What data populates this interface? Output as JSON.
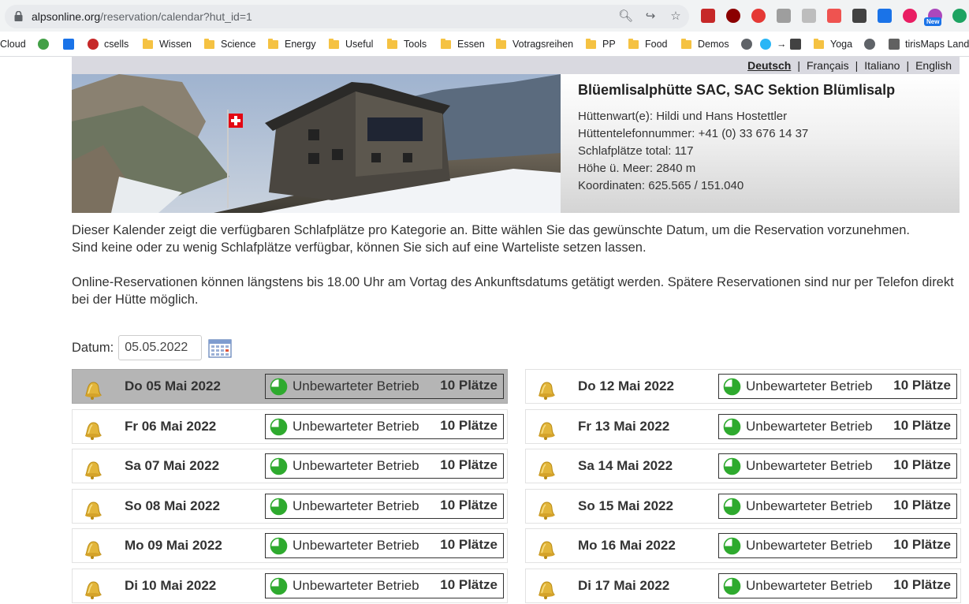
{
  "browser": {
    "url_host": "alpsonline.org",
    "url_path": "/reservation/calendar?hut_id=1",
    "bookmarks": [
      "Cloud",
      "csells",
      "Wissen",
      "Science",
      "Energy",
      "Useful",
      "Tools",
      "Essen",
      "Votragsreihen",
      "PP",
      "Food",
      "Demos",
      "Yoga",
      "tirisMaps Land"
    ],
    "new_badge": "New"
  },
  "languages": [
    "Deutsch",
    "Français",
    "Italiano",
    "English"
  ],
  "hut": {
    "title": "Blüemlisalphütte SAC, SAC Sektion Blümlisalp",
    "warden": "Hüttenwart(e): Hildi und Hans Hostettler",
    "phone": "Hüttentelefonnummer: +41 (0) 33 676 14 37",
    "beds": "Schlafplätze total: 117",
    "altitude": "Höhe ü. Meer: 2840 m",
    "coords": "Koordinaten: 625.565 / 151.040"
  },
  "intro": {
    "p1": "Dieser Kalender zeigt die verfügbaren Schlafplätze pro Kategorie an. Bitte wählen Sie das gewünschte Datum, um die Reservation vorzunehmen.",
    "p2": "Sind keine oder zu wenig Schlafplätze verfügbar, können Sie sich auf eine Warteliste setzen lassen.",
    "p3": "Online-Reservationen können längstens bis 18.00 Uhr am Vortag des Ankunftsdatums getätigt werden. Spätere Reservationen sind nur per Telefon direkt bei der Hütte möglich."
  },
  "date_picker": {
    "label": "Datum:",
    "value": "05.05.2022"
  },
  "days_left": [
    {
      "date": "Do 05 Mai 2022",
      "status": "Unbewarteter Betrieb",
      "places": "10 Plätze",
      "selected": true
    },
    {
      "date": "Fr 06 Mai 2022",
      "status": "Unbewarteter Betrieb",
      "places": "10 Plätze"
    },
    {
      "date": "Sa 07 Mai 2022",
      "status": "Unbewarteter Betrieb",
      "places": "10 Plätze"
    },
    {
      "date": "So 08 Mai 2022",
      "status": "Unbewarteter Betrieb",
      "places": "10 Plätze"
    },
    {
      "date": "Mo 09 Mai 2022",
      "status": "Unbewarteter Betrieb",
      "places": "10 Plätze"
    },
    {
      "date": "Di 10 Mai 2022",
      "status": "Unbewarteter Betrieb",
      "places": "10 Plätze"
    }
  ],
  "days_right": [
    {
      "date": "Do 12 Mai 2022",
      "status": "Unbewarteter Betrieb",
      "places": "10 Plätze"
    },
    {
      "date": "Fr 13 Mai 2022",
      "status": "Unbewarteter Betrieb",
      "places": "10 Plätze"
    },
    {
      "date": "Sa 14 Mai 2022",
      "status": "Unbewarteter Betrieb",
      "places": "10 Plätze"
    },
    {
      "date": "So 15 Mai 2022",
      "status": "Unbewarteter Betrieb",
      "places": "10 Plätze"
    },
    {
      "date": "Mo 16 Mai 2022",
      "status": "Unbewarteter Betrieb",
      "places": "10 Plätze"
    },
    {
      "date": "Di 17 Mai 2022",
      "status": "Unbewarteter Betrieb",
      "places": "10 Plätze"
    }
  ],
  "colors": {
    "occupancy_green": "#2eaa2e",
    "selected_row": "#b5b5b5",
    "lang_bar": "#d9d9e0"
  }
}
